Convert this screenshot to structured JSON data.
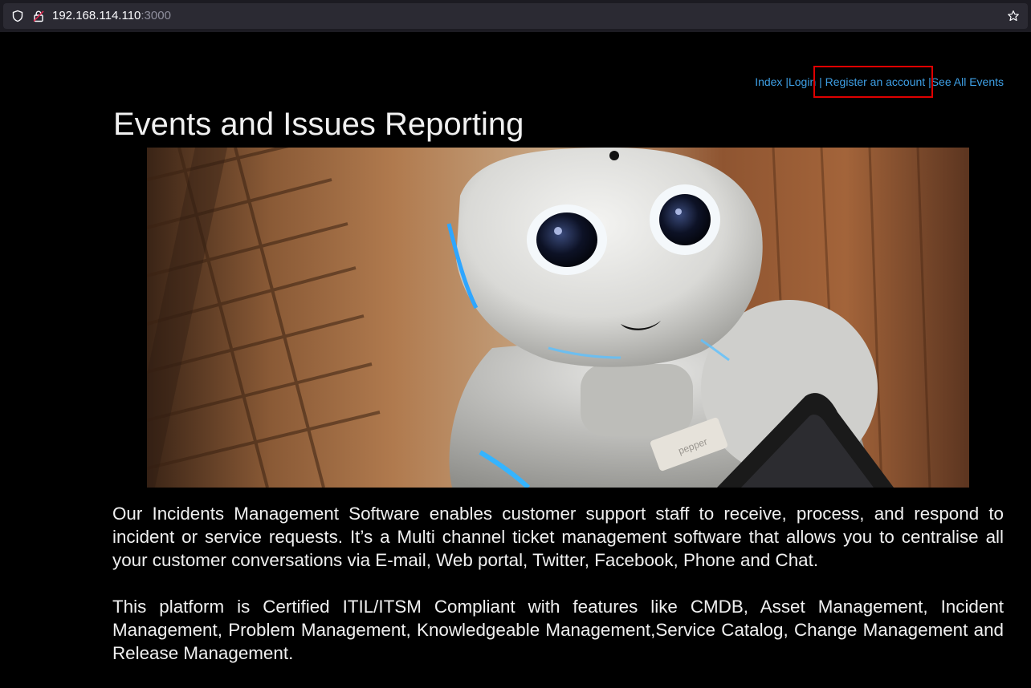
{
  "browser": {
    "url_host": "192.168.114.110",
    "url_port": ":3000"
  },
  "nav": {
    "items": [
      {
        "label": "Index"
      },
      {
        "label": "Login"
      },
      {
        "label": "Register an account"
      },
      {
        "label": "See All Events"
      }
    ],
    "separator": "|",
    "highlighted_item": "Register an account",
    "highlight_color": "#e00000",
    "link_color": "#3ea0e6"
  },
  "page": {
    "title": "Events and Issues Reporting",
    "hero_image": {
      "subject": "white humanoid robot with large eyes",
      "badge_text": "pepper"
    },
    "paragraphs": [
      "Our Incidents Management Software enables customer support staff to receive, process, and respond to incident or service requests. It’s a Multi channel ticket management software that allows you to centralise all your customer conversations via E-mail, Web portal, Twitter, Facebook, Phone and Chat.",
      "This platform is Certified ITIL/ITSM Compliant with features like CMDB, Asset Management, Incident Management, Problem Management, Knowledgeable Management,Service Catalog, Change Management and Release Management."
    ]
  }
}
